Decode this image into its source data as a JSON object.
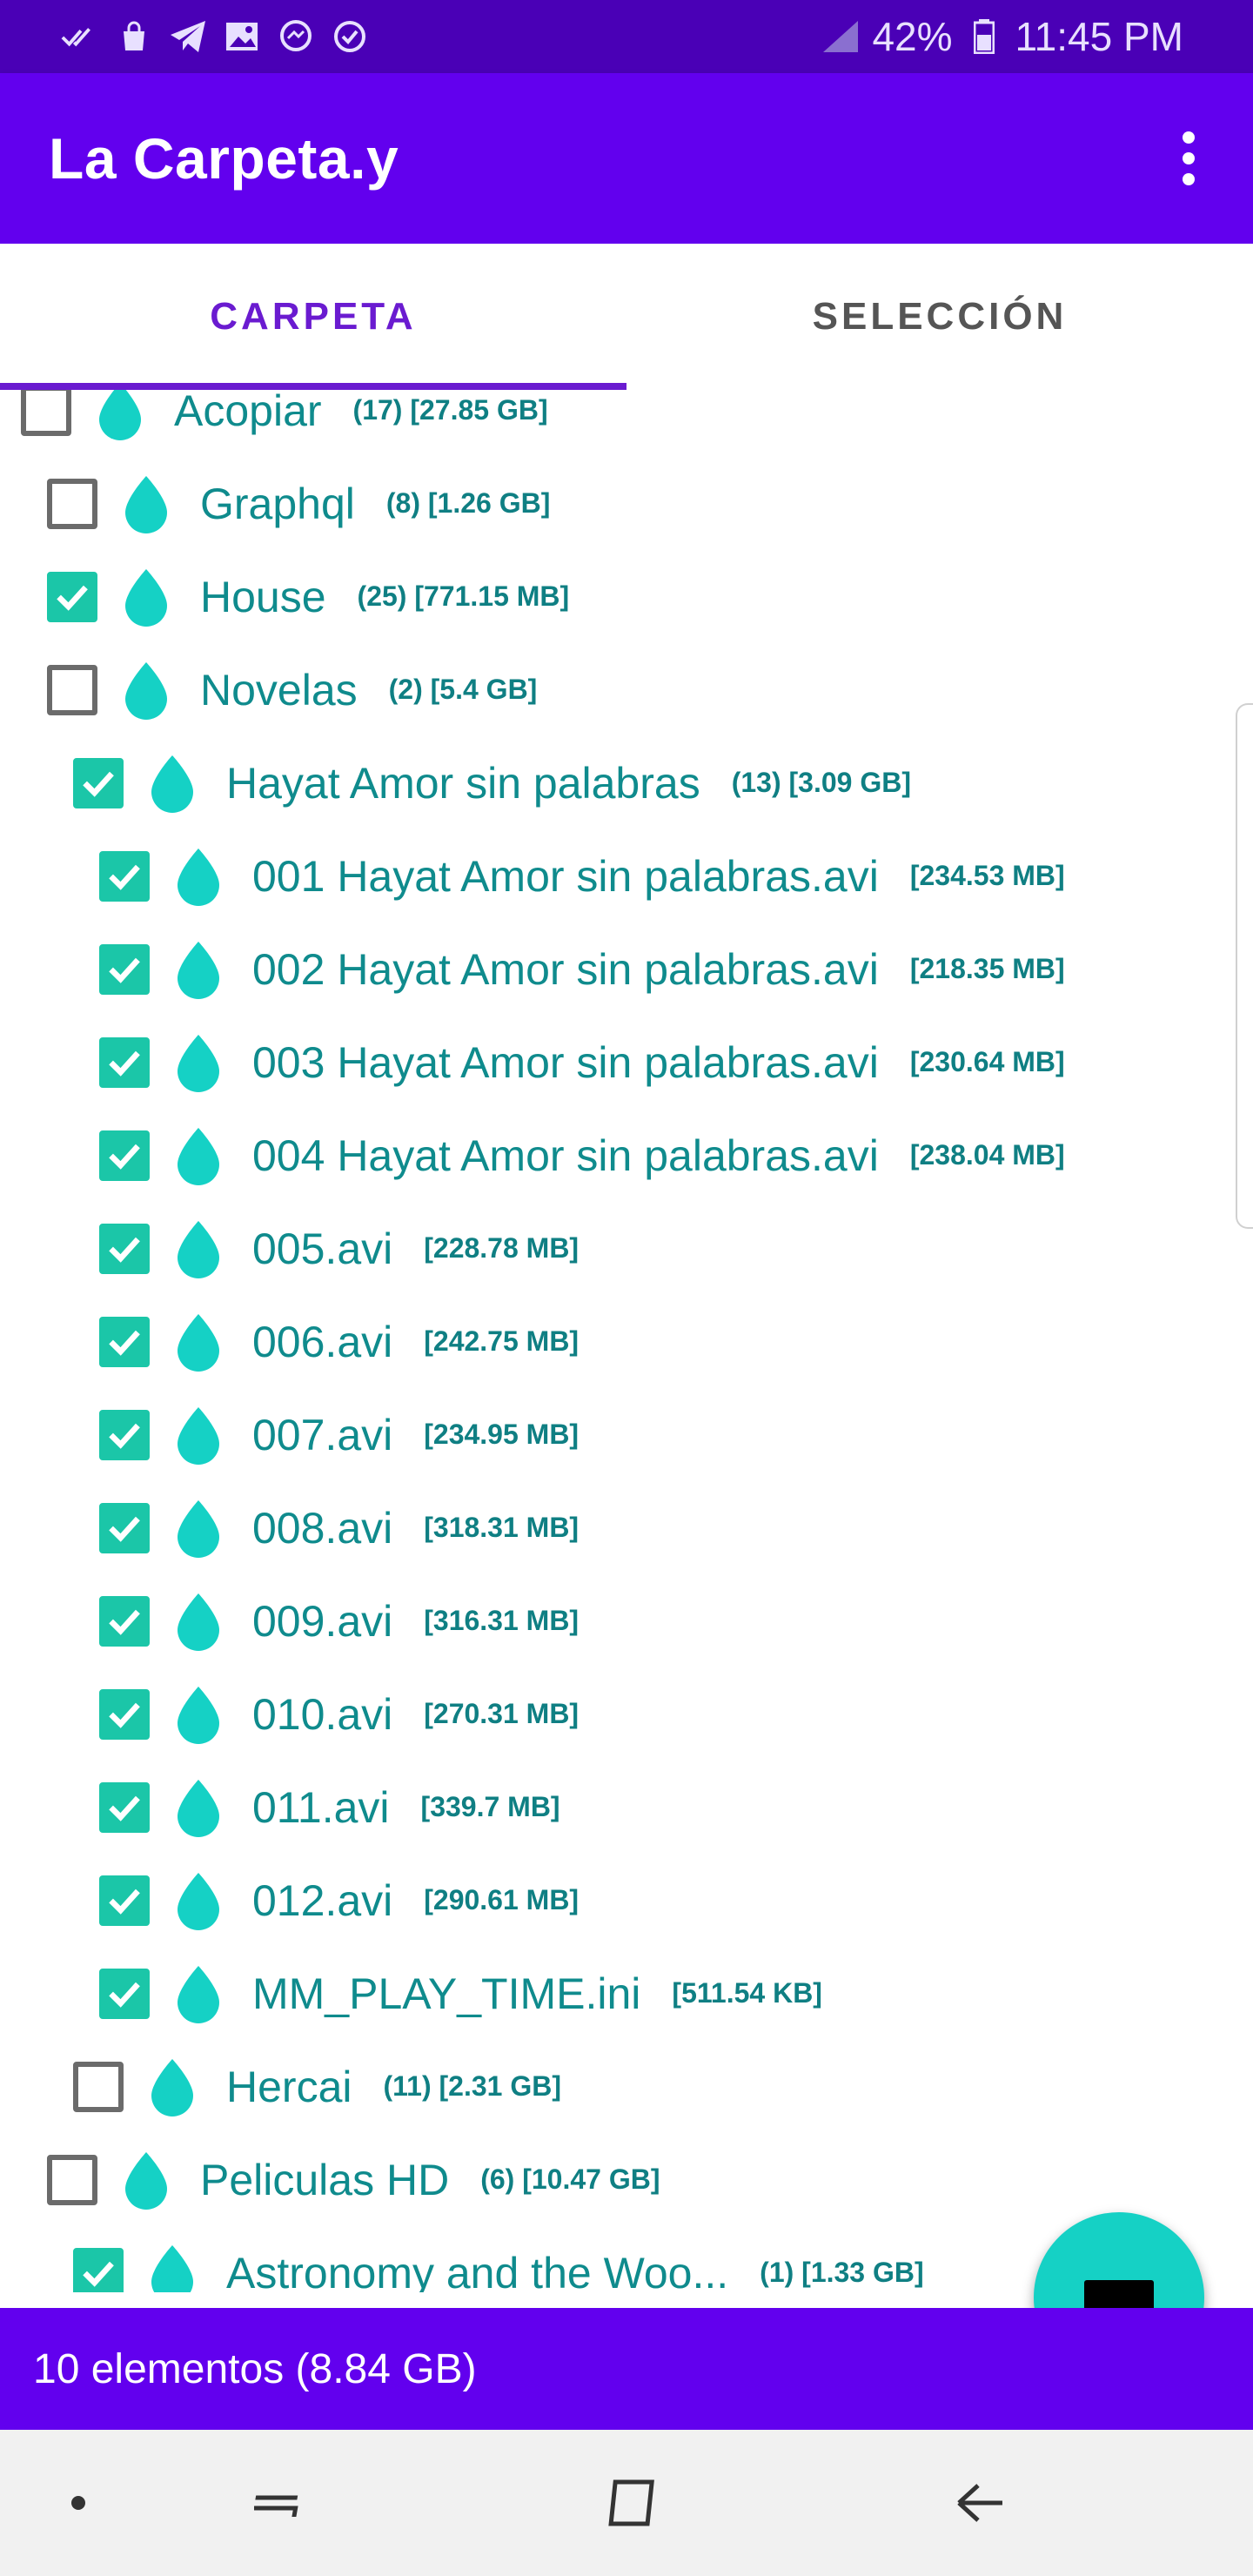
{
  "status_bar": {
    "battery": "42%",
    "time": "11:45 PM",
    "icons": [
      "double-check-icon",
      "shopping-bag-icon",
      "telegram-icon",
      "image-icon",
      "messenger-icon",
      "check-circle-icon",
      "signal-icon",
      "battery-icon"
    ]
  },
  "app_bar": {
    "title": "La Carpeta.y",
    "menu_icon": "more-vert-icon"
  },
  "tabs": [
    {
      "label": "CARPETA",
      "active": true
    },
    {
      "label": "SELECCIÓN",
      "active": false
    }
  ],
  "tree": [
    {
      "level": 0,
      "name": "Acopiar",
      "meta": "(17) [27.85 GB]",
      "checked": false
    },
    {
      "level": 1,
      "name": "Graphql",
      "meta": "(8) [1.26 GB]",
      "checked": false
    },
    {
      "level": 1,
      "name": "House",
      "meta": "(25) [771.15 MB]",
      "checked": true
    },
    {
      "level": 1,
      "name": "Novelas",
      "meta": "(2) [5.4 GB]",
      "checked": false
    },
    {
      "level": 2,
      "name": "Hayat Amor sin palabras",
      "meta": "(13) [3.09 GB]",
      "checked": true
    },
    {
      "level": 3,
      "name": "001 Hayat Amor sin palabras.avi",
      "meta": "[234.53 MB]",
      "checked": true
    },
    {
      "level": 3,
      "name": "002 Hayat Amor sin palabras.avi",
      "meta": "[218.35 MB]",
      "checked": true
    },
    {
      "level": 3,
      "name": "003 Hayat Amor sin palabras.avi",
      "meta": "[230.64 MB]",
      "checked": true
    },
    {
      "level": 3,
      "name": "004 Hayat Amor sin palabras.avi",
      "meta": "[238.04 MB]",
      "checked": true
    },
    {
      "level": 3,
      "name": "005.avi",
      "meta": "[228.78 MB]",
      "checked": true
    },
    {
      "level": 3,
      "name": "006.avi",
      "meta": "[242.75 MB]",
      "checked": true
    },
    {
      "level": 3,
      "name": "007.avi",
      "meta": "[234.95 MB]",
      "checked": true
    },
    {
      "level": 3,
      "name": "008.avi",
      "meta": "[318.31 MB]",
      "checked": true
    },
    {
      "level": 3,
      "name": "009.avi",
      "meta": "[316.31 MB]",
      "checked": true
    },
    {
      "level": 3,
      "name": "010.avi",
      "meta": "[270.31 MB]",
      "checked": true
    },
    {
      "level": 3,
      "name": "011.avi",
      "meta": "[339.7 MB]",
      "checked": true
    },
    {
      "level": 3,
      "name": "012.avi",
      "meta": "[290.61 MB]",
      "checked": true
    },
    {
      "level": 3,
      "name": "MM_PLAY_TIME.ini",
      "meta": "[511.54 KB]",
      "checked": true
    },
    {
      "level": 2,
      "name": "Hercai",
      "meta": "(11) [2.31 GB]",
      "checked": false
    },
    {
      "level": 1,
      "name": "Peliculas HD",
      "meta": "(6) [10.47 GB]",
      "checked": false
    },
    {
      "level": 2,
      "name": "Astronomy and the Woo...",
      "meta": "(1) [1.33 GB]",
      "checked": true
    }
  ],
  "summary": {
    "text": "10 elementos (8.84 GB)"
  },
  "colors": {
    "primary": "#6200ee",
    "status_bar": "#4a00b6",
    "accent": "#15d1c5",
    "check": "#1bc6a8",
    "text_teal": "#0f8b8d"
  },
  "fab": {
    "icon": "minus-icon"
  },
  "nav_bar": {
    "icons": [
      "dot-icon",
      "recent-apps-icon",
      "home-icon",
      "back-icon"
    ]
  }
}
